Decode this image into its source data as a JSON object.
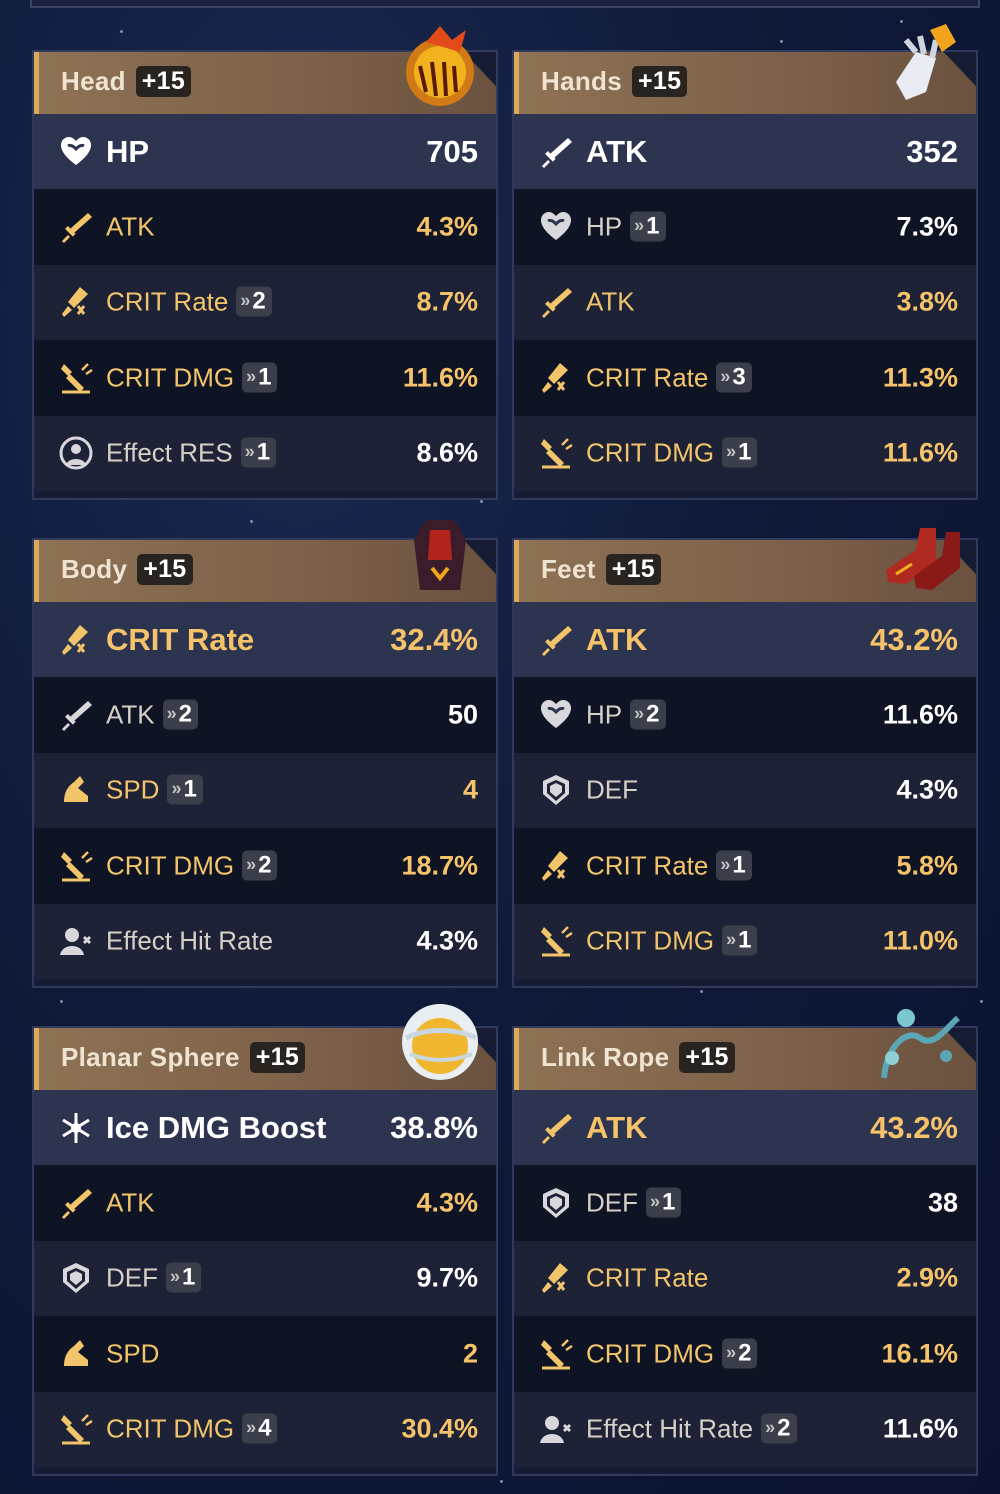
{
  "colors": {
    "gold": "#f6c36a",
    "white": "#ffffff",
    "header_bg": "#8e7255",
    "accent": "#e0aa55"
  },
  "panels": [
    {
      "slot": "Head",
      "level": "+15",
      "main": {
        "icon": "heart-icon",
        "label": "HP",
        "value": "705",
        "gold": false
      },
      "subs": [
        {
          "icon": "sword-icon",
          "label": "ATK",
          "roll": "",
          "value": "4.3%",
          "gold": true
        },
        {
          "icon": "crit-rate-icon",
          "label": "CRIT Rate",
          "roll": "2",
          "value": "8.7%",
          "gold": true
        },
        {
          "icon": "crit-dmg-icon",
          "label": "CRIT DMG",
          "roll": "1",
          "value": "11.6%",
          "gold": true
        },
        {
          "icon": "effect-res-icon",
          "label": "Effect RES",
          "roll": "1",
          "value": "8.6%",
          "gold": false
        }
      ]
    },
    {
      "slot": "Hands",
      "level": "+15",
      "main": {
        "icon": "sword-icon",
        "label": "ATK",
        "value": "352",
        "gold": false
      },
      "subs": [
        {
          "icon": "heart-icon",
          "label": "HP",
          "roll": "1",
          "value": "7.3%",
          "gold": false
        },
        {
          "icon": "sword-icon",
          "label": "ATK",
          "roll": "",
          "value": "3.8%",
          "gold": true
        },
        {
          "icon": "crit-rate-icon",
          "label": "CRIT Rate",
          "roll": "3",
          "value": "11.3%",
          "gold": true
        },
        {
          "icon": "crit-dmg-icon",
          "label": "CRIT DMG",
          "roll": "1",
          "value": "11.6%",
          "gold": true
        }
      ]
    },
    {
      "slot": "Body",
      "level": "+15",
      "main": {
        "icon": "crit-rate-icon",
        "label": "CRIT Rate",
        "value": "32.4%",
        "gold": true
      },
      "subs": [
        {
          "icon": "sword-icon",
          "label": "ATK",
          "roll": "2",
          "value": "50",
          "gold": false
        },
        {
          "icon": "speed-icon",
          "label": "SPD",
          "roll": "1",
          "value": "4",
          "gold": true
        },
        {
          "icon": "crit-dmg-icon",
          "label": "CRIT DMG",
          "roll": "2",
          "value": "18.7%",
          "gold": true
        },
        {
          "icon": "effect-hit-icon",
          "label": "Effect Hit Rate",
          "roll": "",
          "value": "4.3%",
          "gold": false
        }
      ]
    },
    {
      "slot": "Feet",
      "level": "+15",
      "main": {
        "icon": "sword-icon",
        "label": "ATK",
        "value": "43.2%",
        "gold": true
      },
      "subs": [
        {
          "icon": "heart-icon",
          "label": "HP",
          "roll": "2",
          "value": "11.6%",
          "gold": false
        },
        {
          "icon": "shield-icon",
          "label": "DEF",
          "roll": "",
          "value": "4.3%",
          "gold": false
        },
        {
          "icon": "crit-rate-icon",
          "label": "CRIT Rate",
          "roll": "1",
          "value": "5.8%",
          "gold": true
        },
        {
          "icon": "crit-dmg-icon",
          "label": "CRIT DMG",
          "roll": "1",
          "value": "11.0%",
          "gold": true
        }
      ]
    },
    {
      "slot": "Planar Sphere",
      "level": "+15",
      "main": {
        "icon": "ice-icon",
        "label": "Ice DMG Boost",
        "value": "38.8%",
        "gold": false
      },
      "subs": [
        {
          "icon": "sword-icon",
          "label": "ATK",
          "roll": "",
          "value": "4.3%",
          "gold": true
        },
        {
          "icon": "shield-icon",
          "label": "DEF",
          "roll": "1",
          "value": "9.7%",
          "gold": false
        },
        {
          "icon": "speed-icon",
          "label": "SPD",
          "roll": "",
          "value": "2",
          "gold": true
        },
        {
          "icon": "crit-dmg-icon",
          "label": "CRIT DMG",
          "roll": "4",
          "value": "30.4%",
          "gold": true
        }
      ]
    },
    {
      "slot": "Link Rope",
      "level": "+15",
      "main": {
        "icon": "sword-icon",
        "label": "ATK",
        "value": "43.2%",
        "gold": true
      },
      "subs": [
        {
          "icon": "shield-icon",
          "label": "DEF",
          "roll": "1",
          "value": "38",
          "gold": false
        },
        {
          "icon": "crit-rate-icon",
          "label": "CRIT Rate",
          "roll": "",
          "value": "2.9%",
          "gold": true
        },
        {
          "icon": "crit-dmg-icon",
          "label": "CRIT DMG",
          "roll": "2",
          "value": "16.1%",
          "gold": true
        },
        {
          "icon": "effect-hit-icon",
          "label": "Effect Hit Rate",
          "roll": "2",
          "value": "11.6%",
          "gold": false
        }
      ]
    }
  ]
}
